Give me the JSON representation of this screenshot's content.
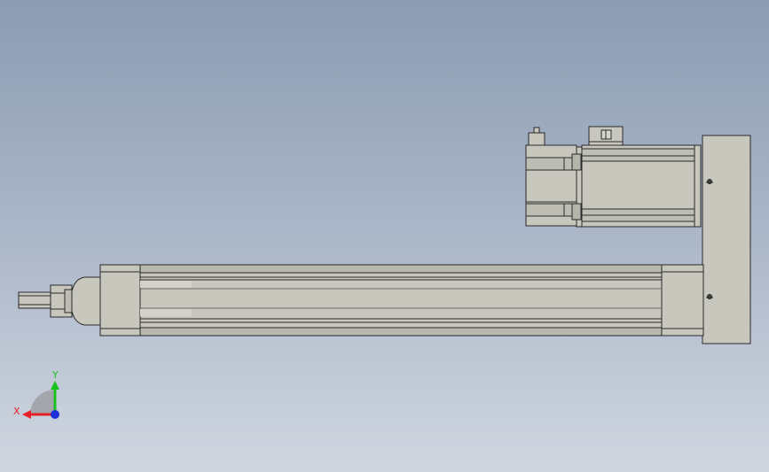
{
  "triad": {
    "x_label": "X",
    "y_label": "Y",
    "x_color": "#e8202a",
    "y_color": "#19c21e",
    "z_color": "#1c2fd8"
  },
  "colors": {
    "body_fill": "#c8c7be",
    "edge": "#2a2a2a",
    "shadow": "#8d8c84"
  }
}
